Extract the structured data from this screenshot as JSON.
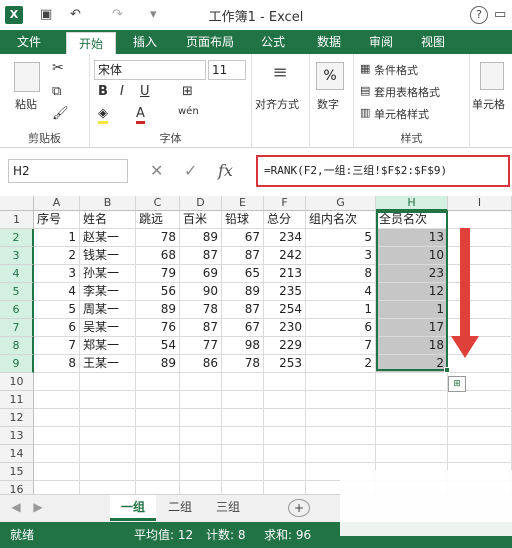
{
  "window": {
    "title": "工作簿1 - Excel",
    "help_label": "?"
  },
  "quick_access": {
    "save_icon": "save-icon",
    "undo_icon": "undo-icon",
    "redo_icon": "redo-icon"
  },
  "ribbon_tabs": [
    "文件",
    "开始",
    "插入",
    "页面布局",
    "公式",
    "数据",
    "审阅",
    "视图"
  ],
  "active_tab": "开始",
  "ribbon": {
    "clipboard": {
      "paste_label": "粘贴",
      "group_label": "剪贴板"
    },
    "font": {
      "font_name": "宋体",
      "font_size": "11",
      "bold": "B",
      "italic": "I",
      "underline": "U",
      "phonetic": "wén",
      "group_label": "字体"
    },
    "alignment": {
      "label": "对齐方式"
    },
    "number": {
      "label": "数字",
      "symbol": "%"
    },
    "styles": {
      "conditional": "条件格式",
      "table": "套用表格格式",
      "cell": "单元格样式",
      "group_label": "样式"
    },
    "cells": {
      "label": "单元格"
    }
  },
  "formula_bar": {
    "name_box": "H2",
    "cancel_glyph": "✕",
    "enter_glyph": "✓",
    "fx_label": "fx",
    "formula": "=RANK(F2,一组:三组!$F$2:$F$9)"
  },
  "columns": [
    "A",
    "B",
    "C",
    "D",
    "E",
    "F",
    "G",
    "H",
    "I"
  ],
  "rows": [
    "1",
    "2",
    "3",
    "4",
    "5",
    "6",
    "7",
    "8",
    "9",
    "10",
    "11",
    "12",
    "13",
    "14",
    "15",
    "16"
  ],
  "headers": [
    "序号",
    "姓名",
    "跳远",
    "百米",
    "铅球",
    "总分",
    "组内名次",
    "全员名次"
  ],
  "data": [
    [
      "1",
      "赵某一",
      "78",
      "89",
      "67",
      "234",
      "5",
      "13"
    ],
    [
      "2",
      "钱某一",
      "68",
      "87",
      "87",
      "242",
      "3",
      "10"
    ],
    [
      "3",
      "孙某一",
      "79",
      "69",
      "65",
      "213",
      "8",
      "23"
    ],
    [
      "4",
      "李某一",
      "56",
      "90",
      "89",
      "235",
      "4",
      "12"
    ],
    [
      "5",
      "周某一",
      "89",
      "78",
      "87",
      "254",
      "1",
      "1"
    ],
    [
      "6",
      "吴某一",
      "76",
      "87",
      "67",
      "230",
      "6",
      "17"
    ],
    [
      "7",
      "郑某一",
      "54",
      "77",
      "98",
      "229",
      "7",
      "18"
    ],
    [
      "8",
      "王某一",
      "89",
      "86",
      "78",
      "253",
      "2",
      "2"
    ]
  ],
  "sheets": [
    "一组",
    "二组",
    "三组"
  ],
  "active_sheet": "一组",
  "add_sheet": "+",
  "status": {
    "ready": "就绪",
    "average": "平均值: 12",
    "count": "计数: 8",
    "sum": "求和: 96"
  },
  "colors": {
    "brand": "#217346",
    "annotation": "#e0403a"
  }
}
